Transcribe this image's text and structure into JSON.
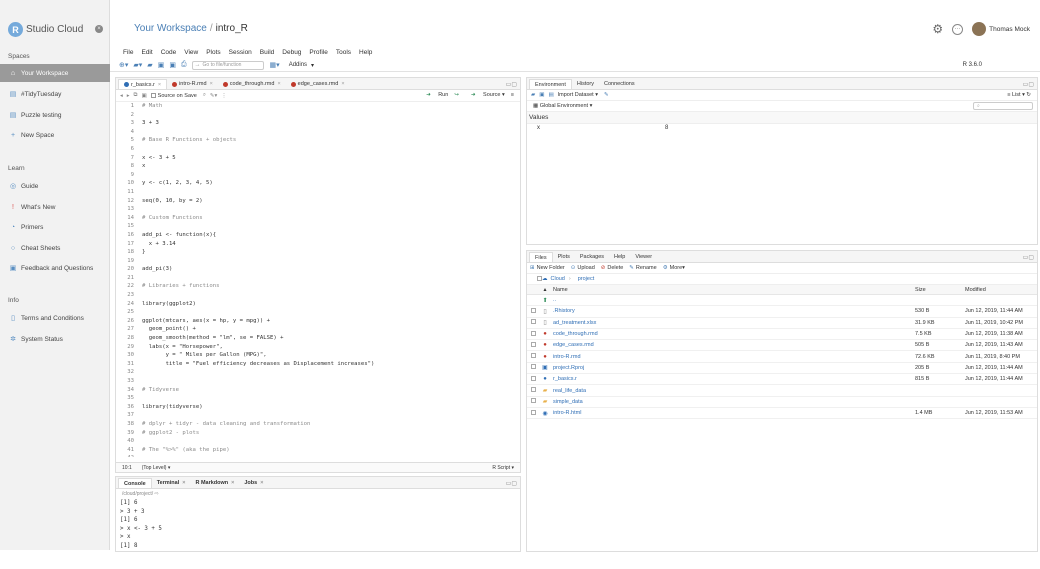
{
  "sidebar": {
    "brand": "Studio Cloud",
    "brand_logo": "R",
    "spaces_heading": "Spaces",
    "spaces": [
      {
        "label": "Your Workspace",
        "icon": "workspace-icon"
      },
      {
        "label": "#TidyTuesday",
        "icon": "workspace-icon"
      },
      {
        "label": "Puzzle testing",
        "icon": "workspace-icon"
      },
      {
        "label": "New Space",
        "icon": "plus-icon"
      }
    ],
    "learn_heading": "Learn",
    "learn": [
      {
        "label": "Guide",
        "icon": "compass-icon"
      },
      {
        "label": "What's New",
        "icon": "exclamation-icon"
      },
      {
        "label": "Primers",
        "icon": "primer-icon"
      },
      {
        "label": "Cheat Sheets",
        "icon": "cheat-sheet-icon"
      },
      {
        "label": "Feedback and Questions",
        "icon": "chat-icon"
      }
    ],
    "info_heading": "Info",
    "info": [
      {
        "label": "Terms and Conditions",
        "icon": "document-icon"
      },
      {
        "label": "System Status",
        "icon": "gear-icon"
      }
    ]
  },
  "header": {
    "workspace": "Your Workspace",
    "separator": "/",
    "project": "intro_R",
    "user": "Thomas Mock"
  },
  "menu": [
    "File",
    "Edit",
    "Code",
    "View",
    "Plots",
    "Session",
    "Build",
    "Debug",
    "Profile",
    "Tools",
    "Help"
  ],
  "toolbar": {
    "goto_placeholder": "Go to file/function",
    "addins": "Addins",
    "r_version": "R 3.6.0"
  },
  "editor": {
    "tabs": [
      {
        "label": "r_basics.r",
        "icon": "r-file",
        "active": true
      },
      {
        "label": "intro-R.rmd",
        "icon": "rmd-file",
        "active": false
      },
      {
        "label": "code_through.rmd",
        "icon": "rmd-file",
        "active": false
      },
      {
        "label": "edge_cases.rmd",
        "icon": "rmd-file",
        "active": false
      }
    ],
    "source_on_save": "Source on Save",
    "run": "Run",
    "source": "Source",
    "lines": [
      "# Math",
      "",
      "3 + 3",
      "",
      "# Base R Functions + objects",
      "",
      "x <- 3 + 5",
      "x",
      "",
      "y <- c(1, 2, 3, 4, 5)",
      "",
      "seq(0, 10, by = 2)",
      "",
      "# Custom Functions",
      "",
      "add_pi <- function(x){",
      "  x + 3.14",
      "}",
      "",
      "add_pi(3)",
      "",
      "# Libraries + functions",
      "",
      "library(ggplot2)",
      "",
      "ggplot(mtcars, aes(x = hp, y = mpg)) +",
      "  geom_point() +",
      "  geom_smooth(method = \"lm\", se = FALSE) +",
      "  labs(x = \"Horsepower\",",
      "       y = \" Miles per Gallon (MPG)\",",
      "       title = \"Fuel efficiency decreases as Displacement increases\")",
      "",
      "",
      "# Tidyverse",
      "",
      "library(tidyverse)",
      "",
      "# dplyr + tidyr - data cleaning and transformation",
      "# ggplot2 - plots",
      "",
      "# The \"%>%\" (aka the pipe)",
      ""
    ],
    "status_pos": "10:1",
    "status_scope": "(Top Level)",
    "status_type": "R Script"
  },
  "console": {
    "tabs": [
      {
        "label": "Console",
        "closable": false
      },
      {
        "label": "Terminal",
        "closable": true
      },
      {
        "label": "R Markdown",
        "closable": true
      },
      {
        "label": "Jobs",
        "closable": true
      }
    ],
    "path": "/cloud/project/",
    "output": [
      "[1] 6",
      "> 3 + 3",
      "[1] 6",
      "> x <- 3 + 5",
      "> x",
      "[1] 8"
    ]
  },
  "env": {
    "tabs": [
      "Environment",
      "History",
      "Connections"
    ],
    "import_dataset": "Import Dataset",
    "list_view": "List",
    "scope": "Global Environment",
    "values_heading": "Values",
    "vars": [
      {
        "name": "x",
        "value": "8"
      }
    ]
  },
  "files": {
    "tabs": [
      "Files",
      "Plots",
      "Packages",
      "Help",
      "Viewer"
    ],
    "toolbar": {
      "new_folder": "New Folder",
      "upload": "Upload",
      "delete": "Delete",
      "rename": "Rename",
      "more": "More"
    },
    "crumbs": [
      "Cloud",
      "project"
    ],
    "columns": {
      "name": "Name",
      "size": "Size",
      "modified": "Modified"
    },
    "up": "..",
    "rows": [
      {
        "name": ".Rhistory",
        "icon": "file",
        "size": "530 B",
        "modified": "Jun 12, 2019, 11:44 AM"
      },
      {
        "name": "ad_treatment.xlsx",
        "icon": "file",
        "size": "31.9 KB",
        "modified": "Jun 11, 2019, 10:42 PM"
      },
      {
        "name": "code_through.rmd",
        "icon": "rmd",
        "size": "7.5 KB",
        "modified": "Jun 12, 2019, 11:38 AM"
      },
      {
        "name": "edge_cases.rmd",
        "icon": "rmd",
        "size": "505 B",
        "modified": "Jun 12, 2019, 11:43 AM"
      },
      {
        "name": "intro-R.rmd",
        "icon": "rmd",
        "size": "72.6 KB",
        "modified": "Jun 11, 2019, 8:40 PM"
      },
      {
        "name": "project.Rproj",
        "icon": "rproj",
        "size": "205 B",
        "modified": "Jun 12, 2019, 11:44 AM"
      },
      {
        "name": "r_basics.r",
        "icon": "r",
        "size": "815 B",
        "modified": "Jun 12, 2019, 11:44 AM"
      },
      {
        "name": "real_life_data",
        "icon": "folder",
        "size": "",
        "modified": ""
      },
      {
        "name": "simple_data",
        "icon": "folder",
        "size": "",
        "modified": ""
      },
      {
        "name": "intro-R.html",
        "icon": "html",
        "size": "1.4 MB",
        "modified": "Jun 12, 2019, 11:53 AM"
      }
    ]
  }
}
